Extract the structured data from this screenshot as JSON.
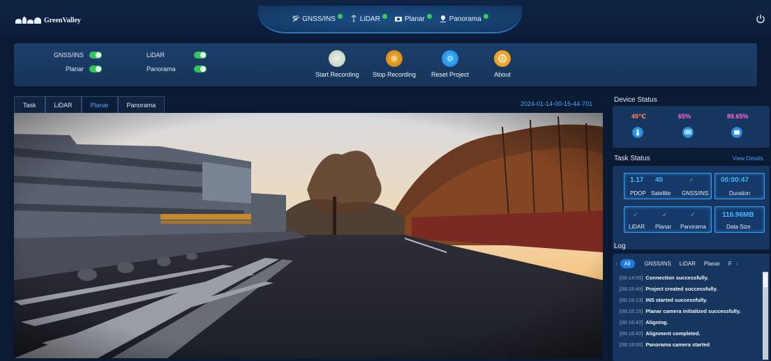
{
  "app": {
    "logo_text": "GreenValley"
  },
  "header": {
    "status": [
      {
        "label": "GNSS/INS",
        "icon": "satellite-icon",
        "color": "#34d058"
      },
      {
        "label": "LiDAR",
        "icon": "lidar-icon",
        "color": "#34d058"
      },
      {
        "label": "Planar",
        "icon": "camera-icon",
        "color": "#34d058"
      },
      {
        "label": "Panorama",
        "icon": "pin-icon",
        "color": "#34d058"
      }
    ]
  },
  "controls": {
    "toggles": [
      {
        "label": "GNSS/INS",
        "on": true
      },
      {
        "label": "Planar",
        "on": true
      },
      {
        "label": "LiDAR",
        "on": true
      },
      {
        "label": "Panorama",
        "on": true
      }
    ],
    "actions": [
      {
        "label": "Start Recording",
        "color": "#d7e6d4",
        "icon": "start-icon"
      },
      {
        "label": "Stop Recording",
        "color": "#e39b1a",
        "icon": "stop-icon"
      },
      {
        "label": "Reset Project",
        "color": "#1e9cff",
        "icon": "reset-icon"
      },
      {
        "label": "About",
        "color": "#f2a42b",
        "icon": "info-icon"
      }
    ]
  },
  "view": {
    "tabs": [
      "Task",
      "LiDAR",
      "Planar",
      "Panorama"
    ],
    "active_tab": "Planar",
    "timestamp": "2024-01-14-00-15-44-701"
  },
  "device_status": {
    "title": "Device Status",
    "temperature": "49℃",
    "memory": "65%",
    "storage": "89.65%"
  },
  "task_status": {
    "title": "Task Status",
    "view_details": "View Details",
    "pdop_value": "1.17",
    "pdop_label": "PDOP",
    "satellite_value": "40",
    "satellite_label": "Satellite",
    "gnss_label": "GNSS/INS",
    "duration_value": "00:00:47",
    "duration_label": "Duration",
    "lidar_label": "LiDAR",
    "planar_label": "Planar",
    "panorama_label": "Panorama",
    "data_size_value": "116.96MB",
    "data_size_label": "Data Size"
  },
  "log": {
    "title": "Log",
    "tabs": [
      "All",
      "GNSS/INS",
      "LiDAR",
      "Planar",
      "F"
    ],
    "entries": [
      {
        "time": "[08:14:00]",
        "message": "Connection successfully."
      },
      {
        "time": "[08:15:49]",
        "message": "Project created successfully."
      },
      {
        "time": "[08:16:13]",
        "message": "INS started successfully."
      },
      {
        "time": "[08:16:15]",
        "message": "Planar camera initialized successfully."
      },
      {
        "time": "[08:16:42]",
        "message": "Aligning."
      },
      {
        "time": "[08:16:42]",
        "message": "Alignment completed."
      },
      {
        "time": "[08:18:00]",
        "message": "Panorama camera started"
      }
    ]
  }
}
